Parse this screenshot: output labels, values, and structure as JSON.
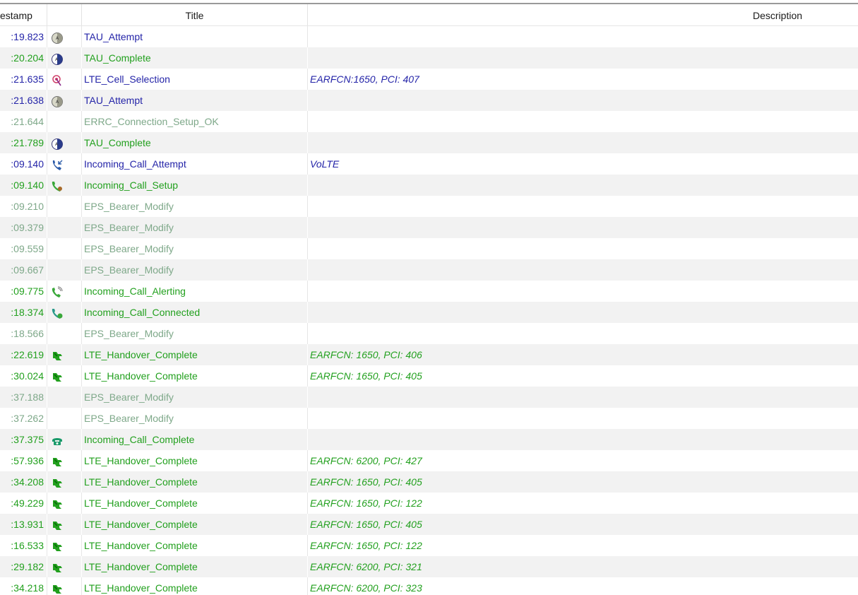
{
  "header": {
    "timestamp_label": "estamp",
    "title_label": "Title",
    "description_label": "Description"
  },
  "rows": [
    {
      "ts": ":19.823",
      "icon": "tau-attempt-icon",
      "title": "TAU_Attempt",
      "desc": "",
      "cat": "blue"
    },
    {
      "ts": ":20.204",
      "icon": "tau-complete-icon",
      "title": "TAU_Complete",
      "desc": "",
      "cat": "green"
    },
    {
      "ts": ":21.635",
      "icon": "cell-selection-icon",
      "title": "LTE_Cell_Selection",
      "desc": "EARFCN:1650, PCI: 407",
      "cat": "blue"
    },
    {
      "ts": ":21.638",
      "icon": "tau-attempt-icon",
      "title": "TAU_Attempt",
      "desc": "",
      "cat": "blue"
    },
    {
      "ts": ":21.644",
      "icon": "",
      "title": "ERRC_Connection_Setup_OK",
      "desc": "",
      "cat": "gray"
    },
    {
      "ts": ":21.789",
      "icon": "tau-complete-icon",
      "title": "TAU_Complete",
      "desc": "",
      "cat": "green"
    },
    {
      "ts": ":09.140",
      "icon": "incoming-call-attempt-icon",
      "title": "Incoming_Call_Attempt",
      "desc": "VoLTE",
      "cat": "blue"
    },
    {
      "ts": ":09.140",
      "icon": "call-setup-icon",
      "title": "Incoming_Call_Setup",
      "desc": "",
      "cat": "green"
    },
    {
      "ts": ":09.210",
      "icon": "",
      "title": "EPS_Bearer_Modify",
      "desc": "",
      "cat": "gray"
    },
    {
      "ts": ":09.379",
      "icon": "",
      "title": "EPS_Bearer_Modify",
      "desc": "",
      "cat": "gray"
    },
    {
      "ts": ":09.559",
      "icon": "",
      "title": "EPS_Bearer_Modify",
      "desc": "",
      "cat": "gray"
    },
    {
      "ts": ":09.667",
      "icon": "",
      "title": "EPS_Bearer_Modify",
      "desc": "",
      "cat": "gray"
    },
    {
      "ts": ":09.775",
      "icon": "call-alerting-icon",
      "title": "Incoming_Call_Alerting",
      "desc": "",
      "cat": "green"
    },
    {
      "ts": ":18.374",
      "icon": "call-connected-icon",
      "title": "Incoming_Call_Connected",
      "desc": "",
      "cat": "green"
    },
    {
      "ts": ":18.566",
      "icon": "",
      "title": "EPS_Bearer_Modify",
      "desc": "",
      "cat": "gray"
    },
    {
      "ts": ":22.619",
      "icon": "handover-icon",
      "title": "LTE_Handover_Complete",
      "desc": "EARFCN: 1650, PCI: 406",
      "cat": "green"
    },
    {
      "ts": ":30.024",
      "icon": "handover-icon",
      "title": "LTE_Handover_Complete",
      "desc": "EARFCN: 1650, PCI: 405",
      "cat": "green"
    },
    {
      "ts": ":37.188",
      "icon": "",
      "title": "EPS_Bearer_Modify",
      "desc": "",
      "cat": "gray"
    },
    {
      "ts": ":37.262",
      "icon": "",
      "title": "EPS_Bearer_Modify",
      "desc": "",
      "cat": "gray"
    },
    {
      "ts": ":37.375",
      "icon": "call-complete-icon",
      "title": "Incoming_Call_Complete",
      "desc": "",
      "cat": "green"
    },
    {
      "ts": ":57.936",
      "icon": "handover-icon",
      "title": "LTE_Handover_Complete",
      "desc": "EARFCN: 6200, PCI: 427",
      "cat": "green"
    },
    {
      "ts": ":34.208",
      "icon": "handover-icon",
      "title": "LTE_Handover_Complete",
      "desc": "EARFCN: 1650, PCI: 405",
      "cat": "green"
    },
    {
      "ts": ":49.229",
      "icon": "handover-icon",
      "title": "LTE_Handover_Complete",
      "desc": "EARFCN: 1650, PCI: 122",
      "cat": "green"
    },
    {
      "ts": ":13.931",
      "icon": "handover-icon",
      "title": "LTE_Handover_Complete",
      "desc": "EARFCN: 1650, PCI: 405",
      "cat": "green"
    },
    {
      "ts": ":16.533",
      "icon": "handover-icon",
      "title": "LTE_Handover_Complete",
      "desc": "EARFCN: 1650, PCI: 122",
      "cat": "green"
    },
    {
      "ts": ":29.182",
      "icon": "handover-icon",
      "title": "LTE_Handover_Complete",
      "desc": "EARFCN: 6200, PCI: 321",
      "cat": "green"
    },
    {
      "ts": ":34.218",
      "icon": "handover-icon",
      "title": "LTE_Handover_Complete",
      "desc": "EARFCN: 6200, PCI: 323",
      "cat": "green"
    }
  ],
  "colors": {
    "blue": "#2424a8",
    "green": "#22a01e",
    "gray": "#7ea889",
    "alt_row": "#f2f2f2"
  }
}
